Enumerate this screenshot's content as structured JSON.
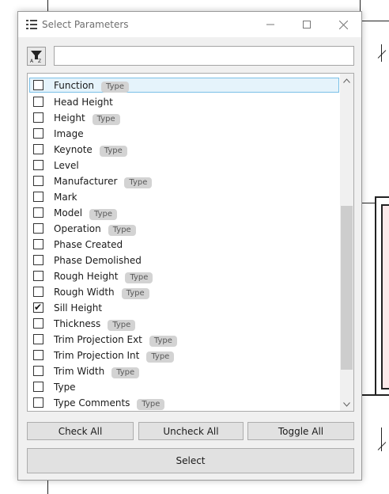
{
  "window": {
    "title": "Select Parameters"
  },
  "search": {
    "value": "",
    "placeholder": ""
  },
  "sort_button": {
    "icon": "sort-az-icon"
  },
  "parameters": [
    {
      "label": "Function",
      "badge": "Type",
      "checked": false,
      "selected": true
    },
    {
      "label": "Head Height",
      "badge": "",
      "checked": false
    },
    {
      "label": "Height",
      "badge": "Type",
      "checked": false
    },
    {
      "label": "Image",
      "badge": "",
      "checked": false
    },
    {
      "label": "Keynote",
      "badge": "Type",
      "checked": false
    },
    {
      "label": "Level",
      "badge": "",
      "checked": false
    },
    {
      "label": "Manufacturer",
      "badge": "Type",
      "checked": false
    },
    {
      "label": "Mark",
      "badge": "",
      "checked": false
    },
    {
      "label": "Model",
      "badge": "Type",
      "checked": false
    },
    {
      "label": "Operation",
      "badge": "Type",
      "checked": false
    },
    {
      "label": "Phase Created",
      "badge": "",
      "checked": false
    },
    {
      "label": "Phase Demolished",
      "badge": "",
      "checked": false
    },
    {
      "label": "Rough Height",
      "badge": "Type",
      "checked": false
    },
    {
      "label": "Rough Width",
      "badge": "Type",
      "checked": false
    },
    {
      "label": "Sill Height",
      "badge": "",
      "checked": true
    },
    {
      "label": "Thickness",
      "badge": "Type",
      "checked": false
    },
    {
      "label": "Trim Projection Ext",
      "badge": "Type",
      "checked": false
    },
    {
      "label": "Trim Projection Int",
      "badge": "Type",
      "checked": false
    },
    {
      "label": "Trim Width",
      "badge": "Type",
      "checked": false
    },
    {
      "label": "Type",
      "badge": "",
      "checked": false
    },
    {
      "label": "Type Comments",
      "badge": "Type",
      "checked": false
    }
  ],
  "buttons": {
    "check_all": "Check All",
    "uncheck_all": "Uncheck All",
    "toggle_all": "Toggle All",
    "select": "Select"
  },
  "colors": {
    "selected_row_bg": "#e5f3fb",
    "selected_row_border": "#7ac0e7",
    "badge_bg": "#d3d3d3",
    "button_bg": "#e1e1e1"
  }
}
